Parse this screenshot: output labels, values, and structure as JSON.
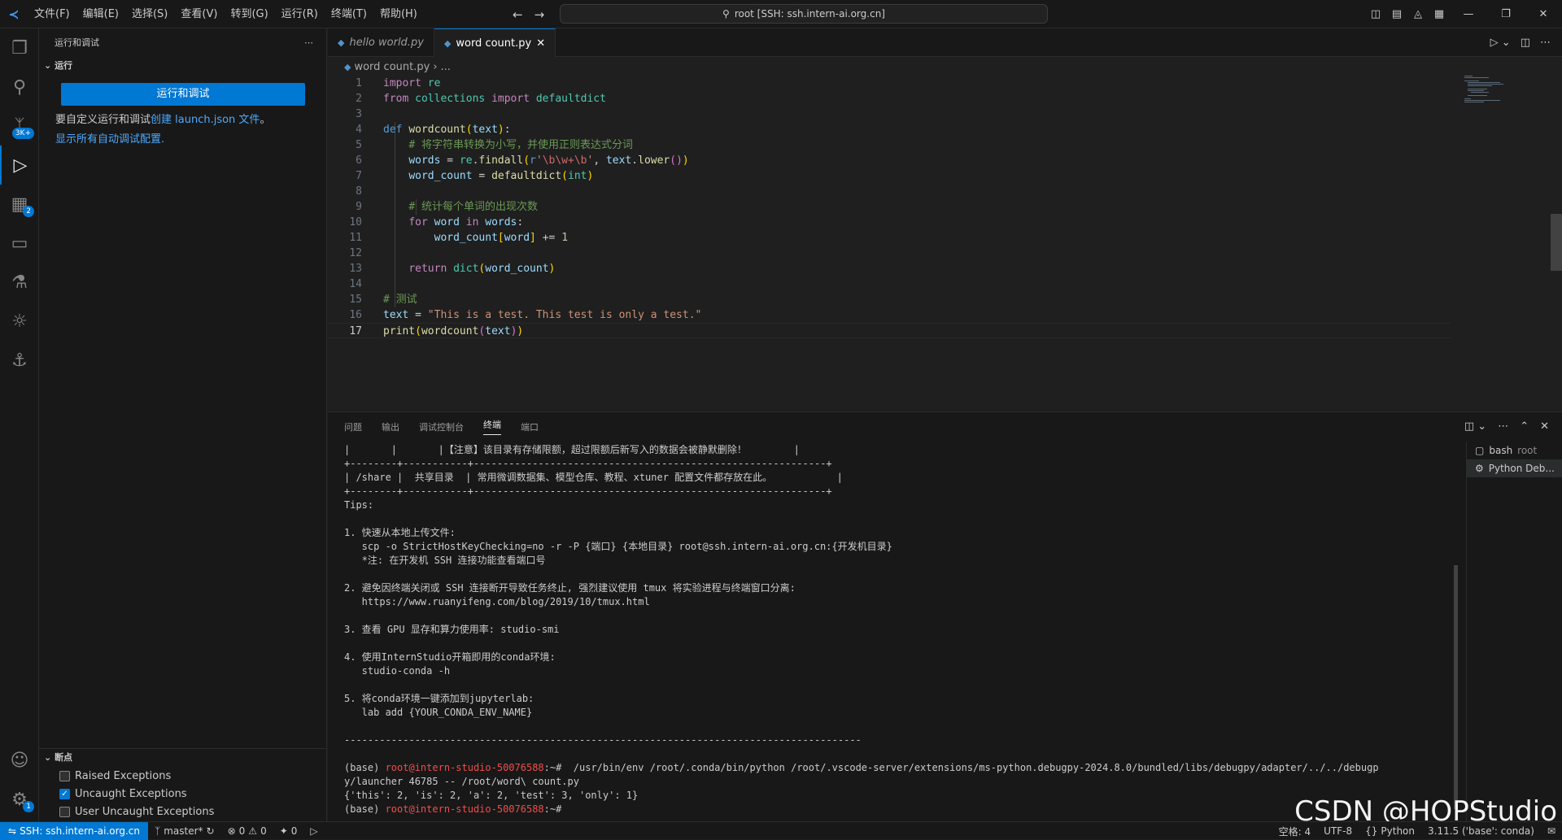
{
  "titlebar": {
    "menu": [
      "文件(F)",
      "编辑(E)",
      "选择(S)",
      "查看(V)",
      "转到(G)",
      "运行(R)",
      "终端(T)",
      "帮助(H)"
    ],
    "command_center": "root [SSH: ssh.intern-ai.org.cn]"
  },
  "activity_badges": {
    "scm": "3K+",
    "extensions": "2",
    "manage": "1"
  },
  "sidebar": {
    "title": "运行和调试",
    "section": "运行",
    "run_button": "运行和调试",
    "hint_prefix": "要自定义运行和调试",
    "hint_link": "创建 launch.json 文件",
    "hint_suffix": "。",
    "show_all": "显示所有自动调试配置.",
    "breakpoints_title": "断点",
    "breakpoints": [
      {
        "label": "Raised Exceptions",
        "checked": false
      },
      {
        "label": "Uncaught Exceptions",
        "checked": true
      },
      {
        "label": "User Uncaught Exceptions",
        "checked": false
      }
    ]
  },
  "tabs": [
    {
      "label": "hello world.py",
      "active": false
    },
    {
      "label": "word count.py",
      "active": true
    }
  ],
  "breadcrumb": {
    "file": "word count.py",
    "rest": "..."
  },
  "editor": {
    "current_line": 17,
    "lines": [
      "import re",
      "from collections import defaultdict",
      "",
      "def wordcount(text):",
      "    # 将字符串转换为小写，并使用正则表达式分词",
      "    words = re.findall(r'\\b\\w+\\b', text.lower())",
      "    word_count = defaultdict(int)",
      "",
      "    # 统计每个单词的出现次数",
      "    for word in words:",
      "        word_count[word] += 1",
      "",
      "    return dict(word_count)",
      "",
      "# 测试",
      "text = \"This is a test. This test is only a test.\"",
      "print(wordcount(text))"
    ]
  },
  "panel": {
    "tabs": [
      "问题",
      "输出",
      "调试控制台",
      "终端",
      "端口"
    ],
    "active_tab": "终端",
    "terminals": [
      {
        "name": "bash",
        "detail": "root"
      },
      {
        "name": "Python Deb...",
        "detail": ""
      }
    ],
    "terminal_lines": [
      "|       |       |【注意】该目录有存储限额，超过限额后新写入的数据会被静默删除！        |",
      "+--------+-----------+------------------------------------------------------------+",
      "| /share |  共享目录  | 常用微调数据集、模型仓库、教程、xtuner 配置文件都存放在此。           |",
      "+--------+-----------+------------------------------------------------------------+",
      "Tips:",
      "",
      "1. 快速从本地上传文件:",
      "   scp -o StrictHostKeyChecking=no -r -P {端口} {本地目录} root@ssh.intern-ai.org.cn:{开发机目录}",
      "   *注: 在开发机 SSH 连接功能查看端口号",
      "",
      "2. 避免因终端关闭或 SSH 连接断开导致任务终止, 强烈建议使用 tmux 将实验进程与终端窗口分离:",
      "   https://www.ruanyifeng.com/blog/2019/10/tmux.html",
      "",
      "3. 查看 GPU 显存和算力使用率: studio-smi",
      "",
      "4. 使用InternStudio开箱即用的conda环境:",
      "   studio-conda -h",
      "",
      "5. 将conda环境一键添加到jupyterlab:",
      "   lab add {YOUR_CONDA_ENV_NAME}",
      "",
      "----------------------------------------------------------------------------------------",
      ""
    ],
    "cmd_prefix": "(base) ",
    "cmd_prompt": "root@intern-studio-50076588",
    "cmd_path": ":~# ",
    "cmd_text": " /usr/bin/env /root/.conda/bin/python /root/.vscode-server/extensions/ms-python.debugpy-2024.8.0/bundled/libs/debugpy/adapter/../../debugp",
    "cmd_cont": "y/launcher 46785 -- /root/word\\ count.py",
    "output": "{'this': 2, 'is': 2, 'a': 2, 'test': 3, 'only': 1}",
    "last_prefix": "(base) ",
    "last_prompt": "root@intern-studio-50076588",
    "last_path": ":~# "
  },
  "statusbar": {
    "remote": "SSH: ssh.intern-ai.org.cn",
    "branch": "master*",
    "errors": "0",
    "warnings": "0",
    "ports": "0",
    "spaces": "空格: 4",
    "encoding": "UTF-8",
    "language": "Python",
    "interpreter": "3.11.5 ('base': conda)"
  },
  "watermark": "CSDN @HOPStudio"
}
